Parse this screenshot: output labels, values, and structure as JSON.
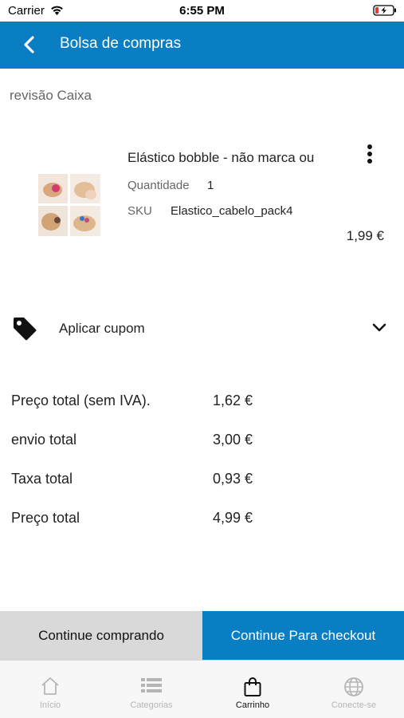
{
  "status_bar": {
    "carrier": "Carrier",
    "time": "6:55 PM"
  },
  "nav": {
    "title": "Bolsa de compras"
  },
  "section_title": "revisão Caixa",
  "product": {
    "name": "Elástico bobble - não marca ou",
    "qty_label": "Quantidade",
    "qty_value": "1",
    "sku_label": "SKU",
    "sku_value": "Elastico_cabelo_pack4",
    "price": "1,99 €"
  },
  "coupon": {
    "label": "Aplicar cupom"
  },
  "totals": [
    {
      "label": "Preço total (sem IVA).",
      "value": "1,62 €"
    },
    {
      "label": "envio total",
      "value": "3,00 €"
    },
    {
      "label": "Taxa total",
      "value": "0,93 €"
    },
    {
      "label": "Preço total",
      "value": "4,99 €"
    }
  ],
  "buttons": {
    "continue": "Continue comprando",
    "checkout": "Continue Para checkout"
  },
  "tabs": [
    {
      "label": "Início",
      "icon": "home-icon",
      "active": false
    },
    {
      "label": "Categorias",
      "icon": "list-icon",
      "active": false
    },
    {
      "label": "Carrinho",
      "icon": "bag-icon",
      "active": true
    },
    {
      "label": "Conecte-se",
      "icon": "globe-icon",
      "active": false
    }
  ],
  "colors": {
    "primary": "#0a7ec2",
    "secondary_button": "#d9d9d9"
  }
}
